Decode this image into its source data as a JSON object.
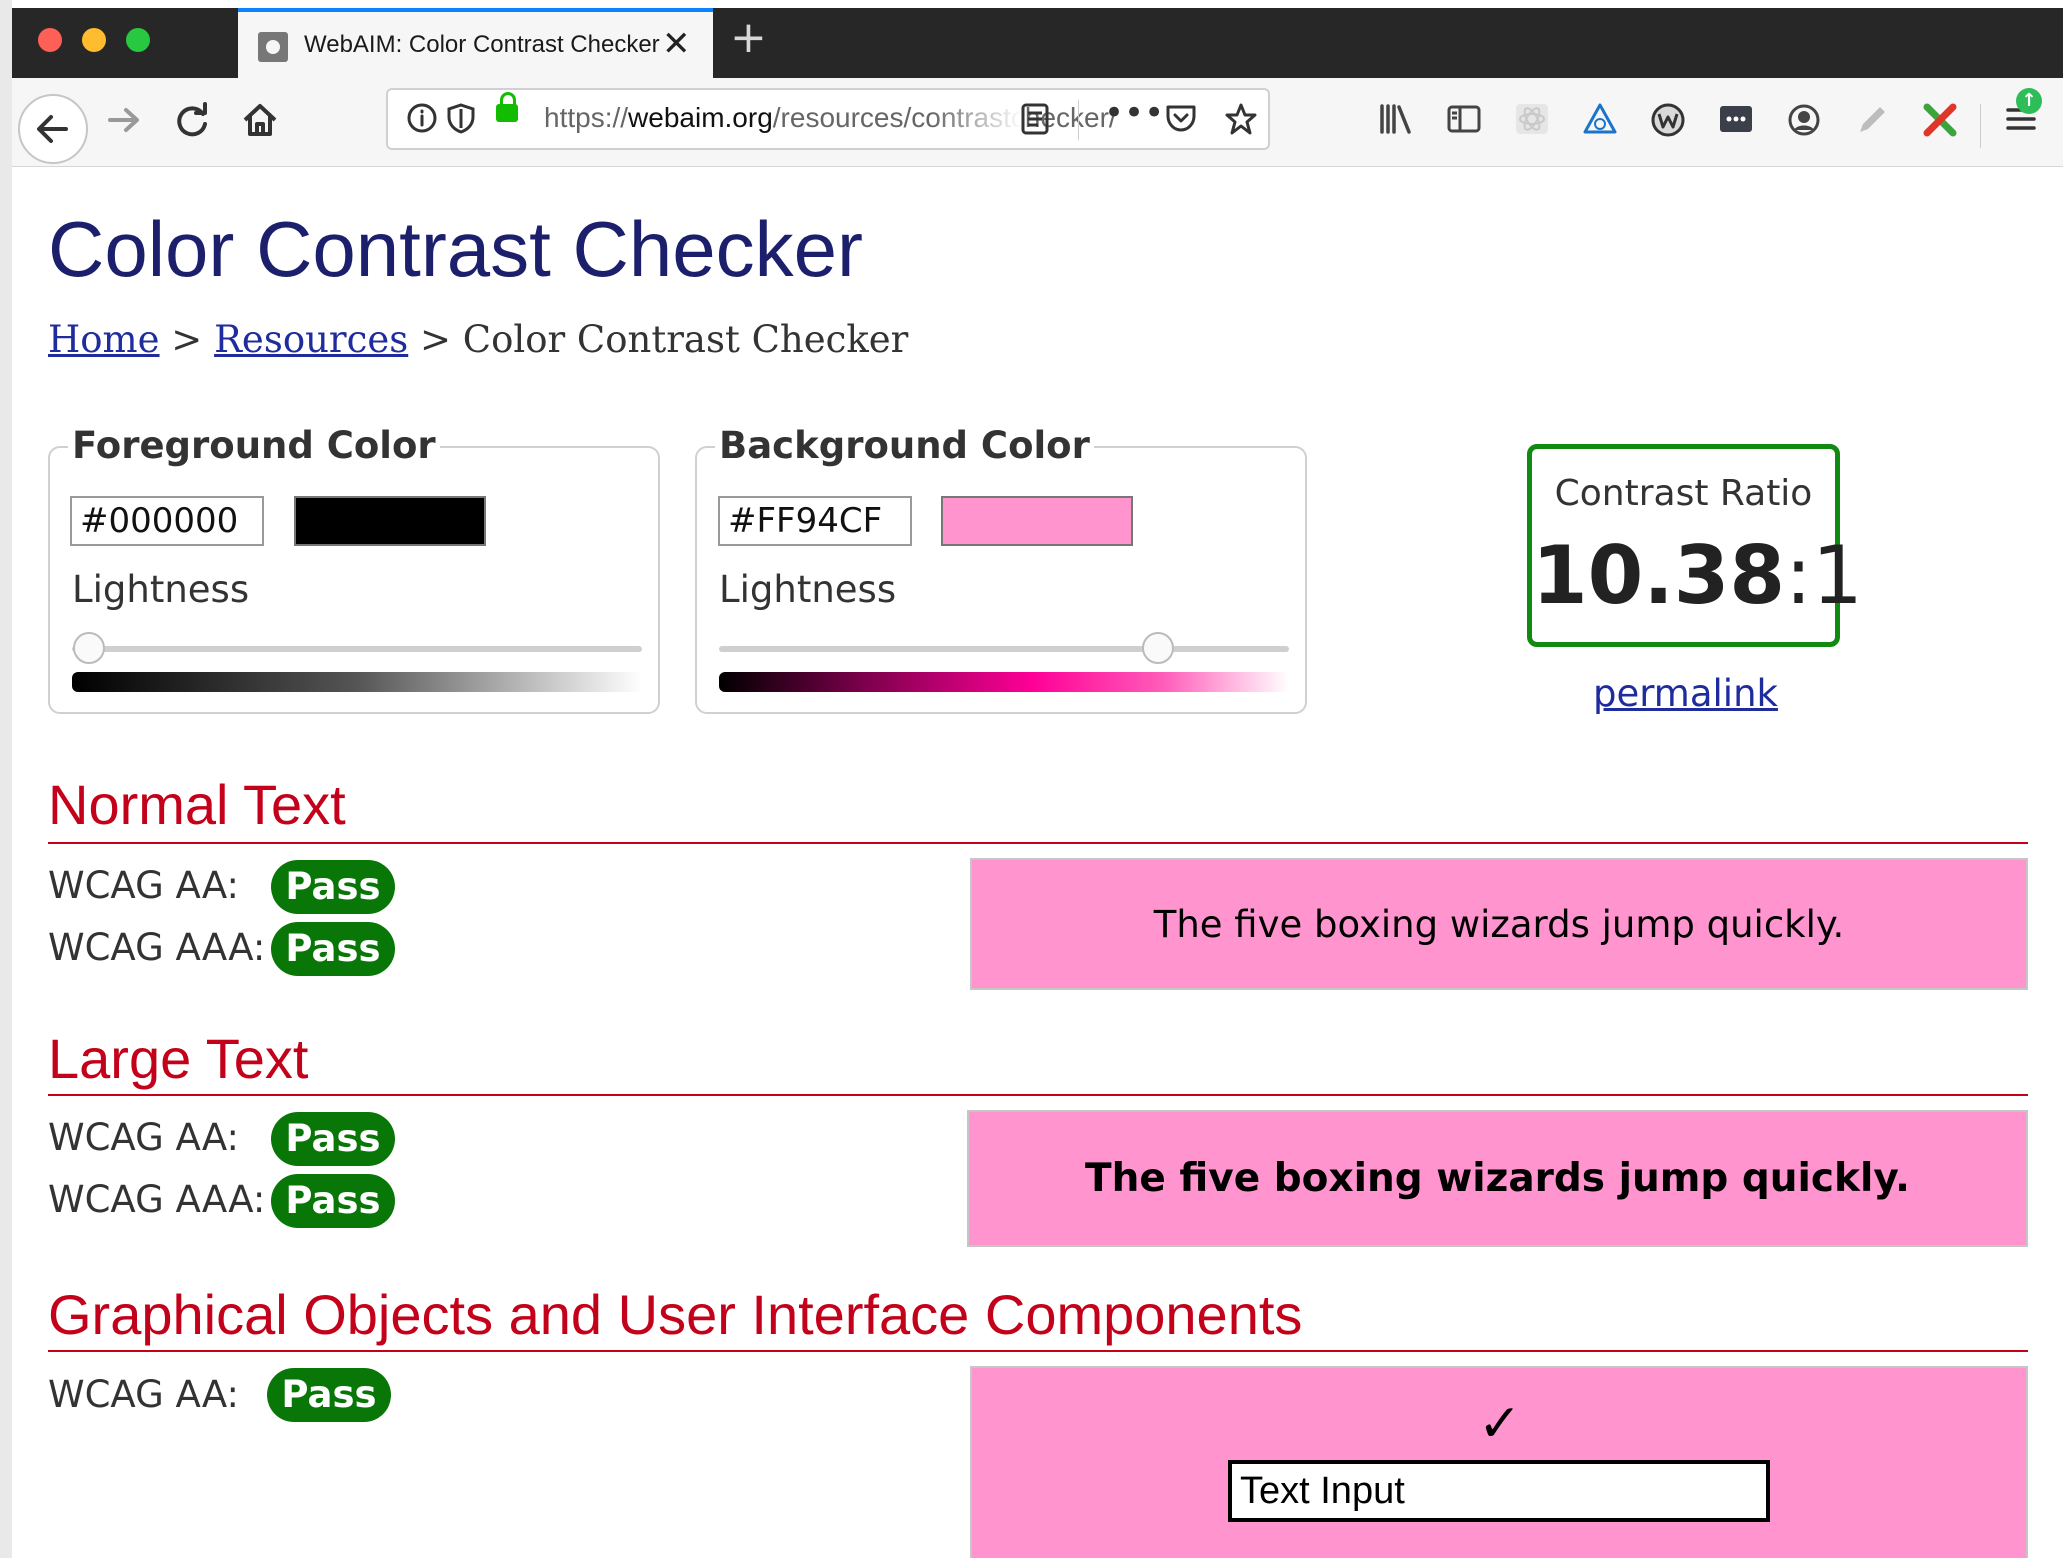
{
  "browser": {
    "tab_title": "WebAIM: Color Contrast Checker",
    "tab_close": "✕",
    "new_tab": "+",
    "url_scheme": "https://",
    "url_host": "webaim.org",
    "url_path": "/resources/contrastchecker/"
  },
  "page": {
    "title": "Color Contrast Checker",
    "breadcrumb": {
      "home": "Home",
      "sep1": ">",
      "resources": "Resources",
      "sep2": ">",
      "current": "Color Contrast Checker"
    },
    "foreground": {
      "legend": "Foreground Color",
      "hex": "#000000",
      "swatch_color": "#000000",
      "lightness_label": "Lightness",
      "lightness_level": 0.03
    },
    "background": {
      "legend": "Background Color",
      "hex": "#FF94CF",
      "swatch_color": "#FF94CF",
      "lightness_label": "Lightness",
      "lightness_level": 0.77
    },
    "contrast": {
      "label": "Contrast Ratio",
      "ratio": "10.38",
      "suffix": ":1",
      "permalink": "permalink"
    },
    "normal_text": {
      "heading": "Normal Text",
      "aa_label": "WCAG AA:",
      "aa_result": "Pass",
      "aaa_label": "WCAG AAA:",
      "aaa_result": "Pass",
      "sample": "The five boxing wizards jump quickly."
    },
    "large_text": {
      "heading": "Large Text",
      "aa_label": "WCAG AA:",
      "aa_result": "Pass",
      "aaa_label": "WCAG AAA:",
      "aaa_result": "Pass",
      "sample": "The five boxing wizards jump quickly."
    },
    "graphical": {
      "heading": "Graphical Objects and User Interface Components",
      "aa_label": "WCAG AA:",
      "aa_result": "Pass",
      "checkmark": "✓",
      "text_input": "Text Input"
    }
  },
  "colors": {
    "heading_red": "#c4011a",
    "title_navy": "#1c1f6b",
    "pass_green": "#087708",
    "preview_bg": "#FF94CF",
    "link_blue": "#1f2c9e"
  }
}
